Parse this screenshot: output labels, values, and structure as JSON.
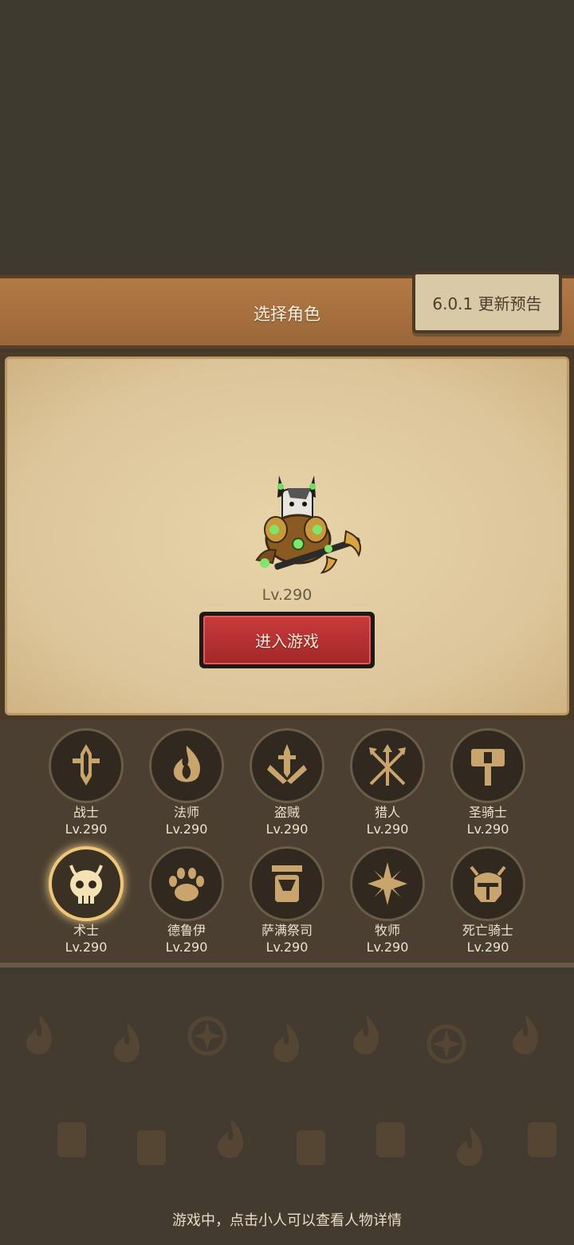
{
  "header": {
    "title": "选择角色",
    "update_label": "6.0.1 更新预告"
  },
  "hero": {
    "level": "Lv.290"
  },
  "enter_button": "进入游戏",
  "classes": [
    {
      "name": "战士",
      "level": "Lv.290",
      "icon": "sword-icon"
    },
    {
      "name": "法师",
      "level": "Lv.290",
      "icon": "flame-icon"
    },
    {
      "name": "盗贼",
      "level": "Lv.290",
      "icon": "daggers-icon"
    },
    {
      "name": "猎人",
      "level": "Lv.290",
      "icon": "arrows-icon"
    },
    {
      "name": "圣骑士",
      "level": "Lv.290",
      "icon": "hammer-icon"
    },
    {
      "name": "术士",
      "level": "Lv.290",
      "icon": "skull-icon",
      "selected": true
    },
    {
      "name": "德鲁伊",
      "level": "Lv.290",
      "icon": "paw-icon"
    },
    {
      "name": "萨满祭司",
      "level": "Lv.290",
      "icon": "totem-icon"
    },
    {
      "name": "牧师",
      "level": "Lv.290",
      "icon": "star-icon"
    },
    {
      "name": "死亡骑士",
      "level": "Lv.290",
      "icon": "helmet-icon"
    }
  ],
  "hint": "游戏中，点击小人可以查看人物详情",
  "colors": {
    "accent": "#c83a3a",
    "gold": "#f0c678",
    "parchment": "#e8d4aa"
  }
}
